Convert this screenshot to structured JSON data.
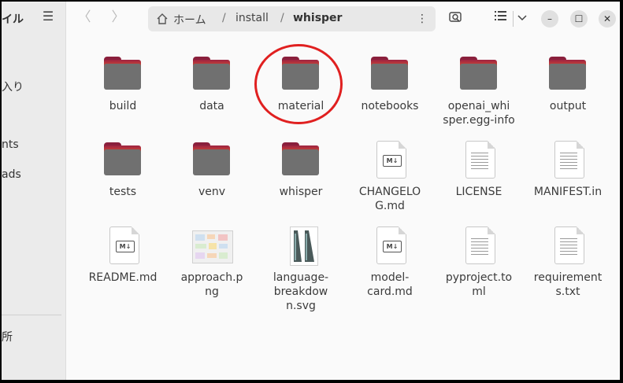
{
  "sidebar": {
    "title": "イル",
    "items": [
      "入り",
      "nts",
      "ads",
      "所"
    ]
  },
  "nav": {
    "back_glyph": "〈",
    "forward_glyph": "〉"
  },
  "path": {
    "home": "ホーム",
    "sep": "/",
    "crumbs": [
      "install",
      "whisper"
    ]
  },
  "files": [
    {
      "name": "build",
      "type": "folder"
    },
    {
      "name": "data",
      "type": "folder"
    },
    {
      "name": "material",
      "type": "folder"
    },
    {
      "name": "notebooks",
      "type": "folder"
    },
    {
      "name": "openai_whisper.egg-info",
      "type": "folder"
    },
    {
      "name": "output",
      "type": "folder"
    },
    {
      "name": "tests",
      "type": "folder"
    },
    {
      "name": "venv",
      "type": "folder"
    },
    {
      "name": "whisper",
      "type": "folder"
    },
    {
      "name": "CHANGELOG.md",
      "type": "markdown"
    },
    {
      "name": "LICENSE",
      "type": "text"
    },
    {
      "name": "MANIFEST.in",
      "type": "text"
    },
    {
      "name": "README.md",
      "type": "markdown"
    },
    {
      "name": "approach.png",
      "type": "image"
    },
    {
      "name": "language-breakdown.svg",
      "type": "svg"
    },
    {
      "name": "model-card.md",
      "type": "markdown"
    },
    {
      "name": "pyproject.toml",
      "type": "text"
    },
    {
      "name": "requirements.txt",
      "type": "text"
    }
  ],
  "labels": {
    "f0": "build",
    "f1": "data",
    "f2": "material",
    "f3": "notebooks",
    "f4a": "openai_whi",
    "f4b": "sper.egg-info",
    "f5": "output",
    "f6": "tests",
    "f7": "venv",
    "f8": "whisper",
    "f9a": "CHANGELO",
    "f9b": "G.md",
    "f10": "LICENSE",
    "f11": "MANIFEST.in",
    "f12": "README.md",
    "f13a": "approach.p",
    "f13b": "ng",
    "f14a": "language-",
    "f14b": "breakdow",
    "f14c": "n.svg",
    "f15a": "model-",
    "f15b": "card.md",
    "f16a": "pyproject.to",
    "f16b": "ml",
    "f17a": "requirement",
    "f17b": "s.txt",
    "md_badge": "M↓"
  },
  "icons": [
    "menu-icon",
    "home-icon",
    "path-menu-icon",
    "search-icon",
    "view-list-icon",
    "chevron-down-icon",
    "minimize-icon",
    "maximize-icon",
    "close-icon"
  ],
  "annotation": {
    "color": "#e02020",
    "target": "material"
  }
}
